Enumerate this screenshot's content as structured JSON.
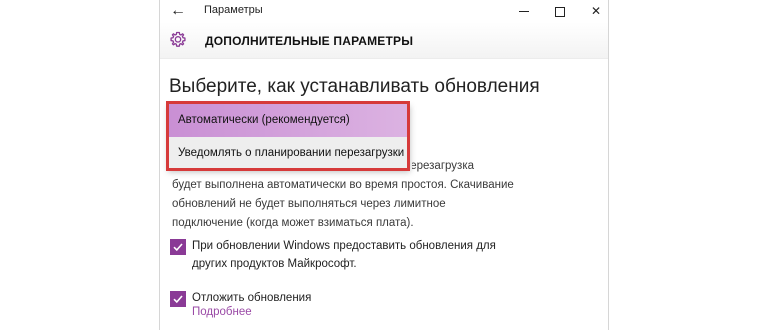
{
  "window": {
    "title": "Параметры",
    "back_icon": "arrow-left-icon",
    "controls": [
      "minimize",
      "maximize",
      "close"
    ]
  },
  "header": {
    "icon": "gear-icon",
    "title": "ДОПОЛНИТЕЛЬНЫЕ ПАРАМЕТРЫ"
  },
  "section": {
    "title": "Выберите, как устанавливать обновления"
  },
  "dropdown": {
    "options": [
      "Автоматически (рекомендуется)",
      "Уведомлять о планировании перезагрузки"
    ],
    "selected_index": 0
  },
  "description": {
    "lines": [
      "перезагрузка",
      "будет выполнена автоматически во время простоя. Скачивание",
      "обновлений не будет выполняться через лимитное",
      "подключение (когда может взиматься плата)."
    ]
  },
  "checkboxes": [
    {
      "label": "При обновлении Windows предоставить обновления для других продуктов Майкрософт.",
      "checked": true
    },
    {
      "label": "Отложить обновления",
      "checked": true
    }
  ],
  "link": {
    "label": "Подробнее"
  },
  "colors": {
    "accent": "#8a3a96",
    "highlight_border": "#d63a3a",
    "selected_option": "#c98fd4"
  }
}
